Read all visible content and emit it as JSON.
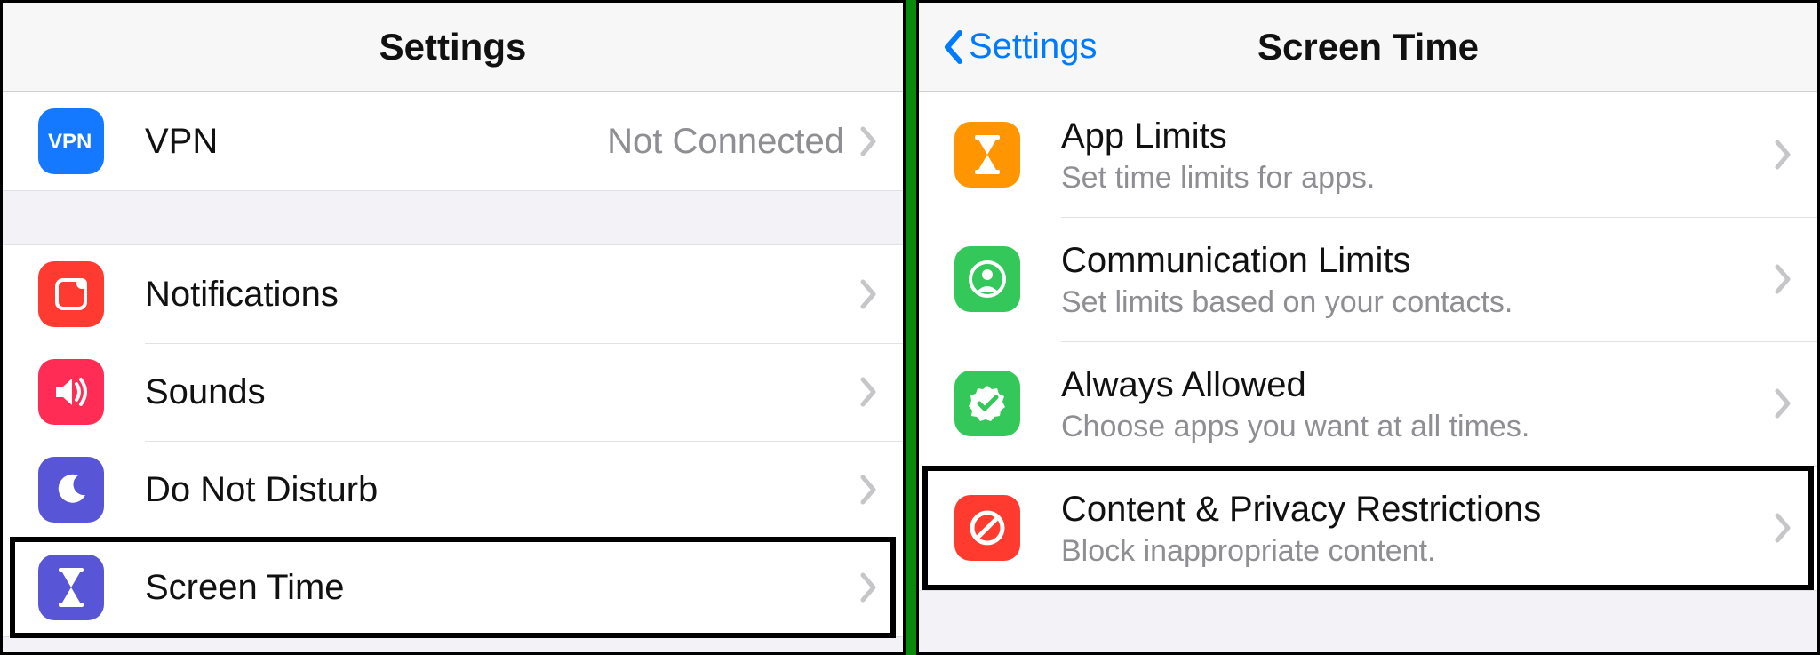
{
  "left": {
    "title": "Settings",
    "group1": {
      "vpn": {
        "label": "VPN",
        "value": "Not Connected"
      }
    },
    "group2": {
      "notifications": {
        "label": "Notifications"
      },
      "sounds": {
        "label": "Sounds"
      },
      "dnd": {
        "label": "Do Not Disturb"
      },
      "screentime": {
        "label": "Screen Time"
      }
    }
  },
  "right": {
    "back_label": "Settings",
    "title": "Screen Time",
    "items": {
      "app_limits": {
        "label": "App Limits",
        "sub": "Set time limits for apps."
      },
      "comm_limits": {
        "label": "Communication Limits",
        "sub": "Set limits based on your contacts."
      },
      "always_allowed": {
        "label": "Always Allowed",
        "sub": "Choose apps you want at all times."
      },
      "content_privacy": {
        "label": "Content & Privacy Restrictions",
        "sub": "Block inappropriate content."
      }
    }
  }
}
